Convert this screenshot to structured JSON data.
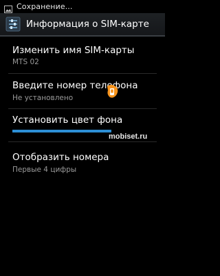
{
  "status_bar": {
    "text": "Сохранение...",
    "icon": "image-icon"
  },
  "action_bar": {
    "icon": "settings-sliders-icon",
    "title": "Информация о SIM-карте"
  },
  "items": [
    {
      "title": "Изменить имя SIM-карты",
      "subtitle": "MTS 02"
    },
    {
      "title": "Введите номер телефона",
      "subtitle": "Не установлено"
    },
    {
      "title": "Установить цвет фона",
      "progress": 1.0
    },
    {
      "title": "Отобразить номера",
      "subtitle": "Первые 4 цифры"
    }
  ],
  "watermark": "mobiset.ru",
  "colors": {
    "accent": "#2d8fd5",
    "background": "#000000",
    "logo": "#f7941d"
  }
}
